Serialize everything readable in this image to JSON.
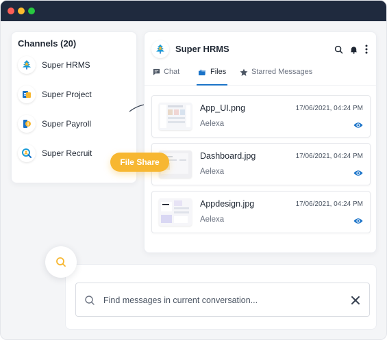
{
  "channels": {
    "title": "Channels (20)",
    "items": [
      {
        "label": "Super HRMS",
        "icon": "tree-logo-icon"
      },
      {
        "label": "Super Project",
        "icon": "project-logo-icon"
      },
      {
        "label": "Super Payroll",
        "icon": "payroll-logo-icon"
      },
      {
        "label": "Super Recruit",
        "icon": "recruit-logo-icon"
      }
    ]
  },
  "chat": {
    "title": "Super HRMS",
    "tabs": [
      {
        "label": "Chat",
        "icon": "chat-icon"
      },
      {
        "label": "Files",
        "icon": "folder-icon",
        "active": true
      },
      {
        "label": "Starred Messages",
        "icon": "star-icon"
      }
    ],
    "files": [
      {
        "name": "App_UI.png",
        "author": "Aelexa",
        "date": "17/06/2021, 04:24 PM"
      },
      {
        "name": "Dashboard.jpg",
        "author": "Aelexa",
        "date": "17/06/2021, 04:24 PM"
      },
      {
        "name": "Appdesign.jpg",
        "author": "Aelexa",
        "date": "17/06/2021, 04:24 PM"
      }
    ]
  },
  "badge": {
    "label": "File Share"
  },
  "search": {
    "placeholder": "Find messages in current conversation..."
  },
  "colors": {
    "accent": "#1a73c8",
    "badge": "#f7b731",
    "titlebar": "#1f2a3e"
  }
}
